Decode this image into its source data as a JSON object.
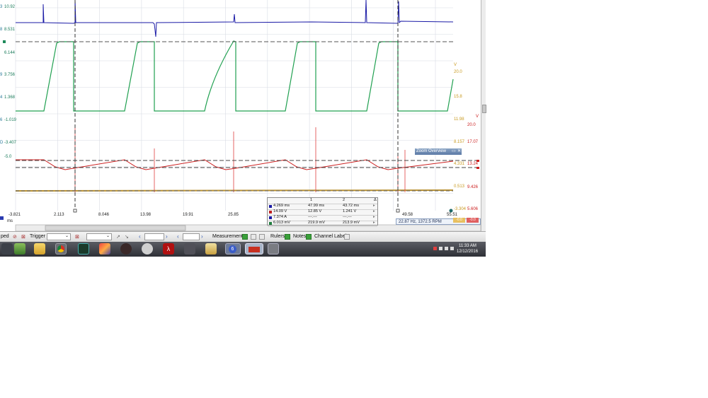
{
  "left_axis": {
    "labels": [
      {
        "ch": "3",
        "value": "10.92"
      },
      {
        "ch": "8",
        "value": "8.531"
      },
      {
        "ch": "",
        "value": "6.144"
      },
      {
        "ch": "9",
        "value": "3.756"
      },
      {
        "ch": "4",
        "value": "1.368"
      },
      {
        "ch": "6",
        "value": "-1.019"
      },
      {
        "ch": "D",
        "value": "-3.407"
      },
      {
        "ch": "",
        "value": "-5.0"
      }
    ]
  },
  "right_axis": {
    "orange_unit": "V",
    "orange_labels": [
      "20.0",
      "15.8",
      "11.98",
      "8.157",
      "4.331",
      "0.513",
      "-3.304"
    ],
    "red_unit": "V",
    "red_labels": [
      "20.0",
      "17.07",
      "13.24",
      "9.426",
      "5.606"
    ],
    "bottom_tags": [
      "-0.0",
      "-0.0"
    ]
  },
  "time_axis": {
    "labels": [
      "-3.821",
      "2.113",
      "8.046",
      "13.98",
      "19.91",
      "25.85",
      "49.58",
      "55.51"
    ],
    "unit": "ms"
  },
  "zoom_overview": {
    "title": "Zoom Overview"
  },
  "measurements": {
    "rows": [
      {
        "color": "#1a1aa6",
        "a": "4.269 ms",
        "b": "47.99 ms",
        "delta": "43.72 ms"
      },
      {
        "color": "#c02020",
        "a": "14.09 V",
        "b": "12.85 V",
        "delta": "1.241 V"
      },
      {
        "color": "#1a1aa6",
        "a": "7.374 A",
        "b": "---.---",
        "delta": "---.---"
      },
      {
        "color": "#208040",
        "a": "6.013 mV",
        "b": "219.9 mV",
        "delta": "213.9 mV"
      }
    ]
  },
  "frequency_readout": "22.87 Hz, 1372.5 RPM",
  "toolbar": {
    "speed_label": "ped",
    "trigger_label": "Trigger",
    "measurements_label": "Measurements",
    "rulers_label": "Rulers",
    "notes_label": "Notes",
    "channel_labels_label": "Channel Labels"
  },
  "taskbar": {
    "time": "11:33 AM",
    "date": "12/12/2016",
    "icons": [
      "explorer-icon",
      "folder-icon",
      "chrome-icon",
      "scope-app-icon",
      "paint-icon",
      "media-icon",
      "tools-icon",
      "acrobat-icon",
      "scanner-icon",
      "archive-icon",
      "app-6-icon",
      "picoscope-icon",
      "network-app-icon"
    ]
  },
  "colors": {
    "blue": "#1a1aa6",
    "green": "#20a050",
    "red": "#cc2020",
    "orange": "#c89a20",
    "grid": "#d8dce4"
  }
}
